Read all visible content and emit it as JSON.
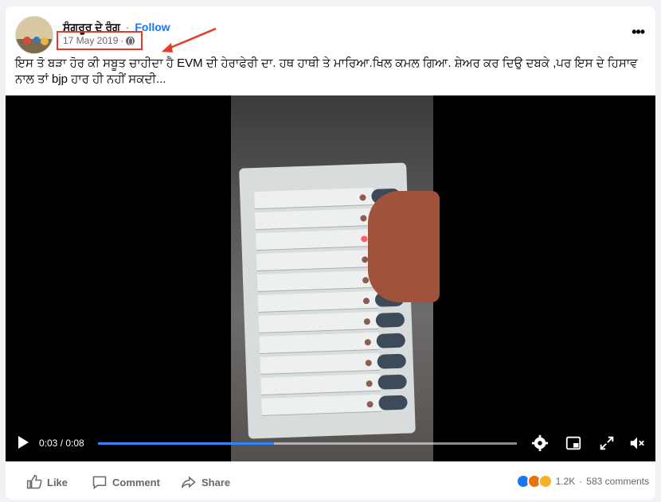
{
  "post": {
    "page_name": "ਸੰਗਰੂਰ ਦੇ ਰੰਗ",
    "separator": "·",
    "follow_label": "Follow",
    "timestamp": "17 May 2019",
    "timestamp_sep": "·",
    "privacy_icon": "globe-icon",
    "more_label": "•••",
    "caption": "ਇਸ ਤੋ ਬੜਾ ਹੋਰ ਕੀ ਸਬੂਤ ਚਾਹੀਦਾ ਹੈ EVM ਦੀ ਹੇਰਾਫੇਰੀ ਦਾ. ਹਥ ਹਾਥੀ ਤੇ ਮਾਰਿਆ.ਖਿਲ ਕਮਲ ਗਿਆ. ਸ਼ੇਅਰ ਕਰ ਦਿਉ ਦਬਕੇ ,ਪਰ ਇਸ ਦੇ ਹਿਸਾਵ ਨਾਲ ਤਾਂ bjp ਹਾਰ ਹੀ ਨਹੀਂ ਸਕਦੀ..."
  },
  "video": {
    "current_time": "0:03",
    "time_sep": " / ",
    "duration": "0:08",
    "progress_fraction": 0.42,
    "progress_color": "#2d88ff",
    "icons": [
      "play-icon",
      "settings-icon",
      "pip-icon",
      "fullscreen-icon",
      "volume-muted-icon"
    ]
  },
  "footer": {
    "like_label": "Like",
    "comment_label": "Comment",
    "share_label": "Share",
    "reaction_count": "1.2K",
    "dot": "·",
    "comment_count": "583 comments",
    "reaction_icons": [
      "like-reaction-icon",
      "angry-reaction-icon",
      "haha-reaction-icon"
    ]
  },
  "annotation": {
    "highlight_color": "#e53b28"
  }
}
